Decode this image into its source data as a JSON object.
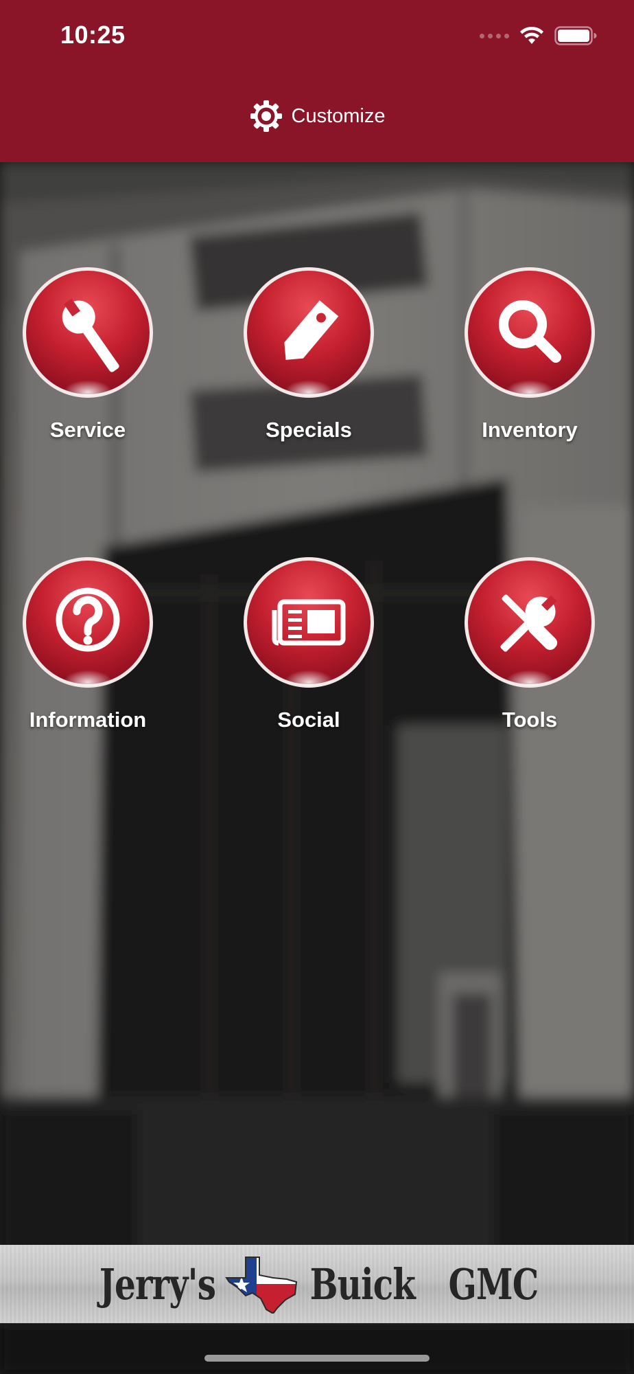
{
  "status_bar": {
    "time": "10:25"
  },
  "header": {
    "customize_label": "Customize",
    "background_color": "#8a1529"
  },
  "grid": {
    "items": [
      {
        "label": "Service",
        "icon": "wrench-icon"
      },
      {
        "label": "Specials",
        "icon": "price-tag-icon"
      },
      {
        "label": "Inventory",
        "icon": "magnifier-icon"
      },
      {
        "label": "Information",
        "icon": "question-mark-icon"
      },
      {
        "label": "Social",
        "icon": "newspaper-icon"
      },
      {
        "label": "Tools",
        "icon": "wrench-screwdriver-icon"
      }
    ]
  },
  "footer": {
    "brand_word_1": "Jerry's",
    "brand_word_2": "Buick",
    "brand_word_3": "GMC"
  },
  "colors": {
    "accent_red": "#c4202f",
    "header_red": "#8a1529",
    "label_white": "#ffffff"
  }
}
